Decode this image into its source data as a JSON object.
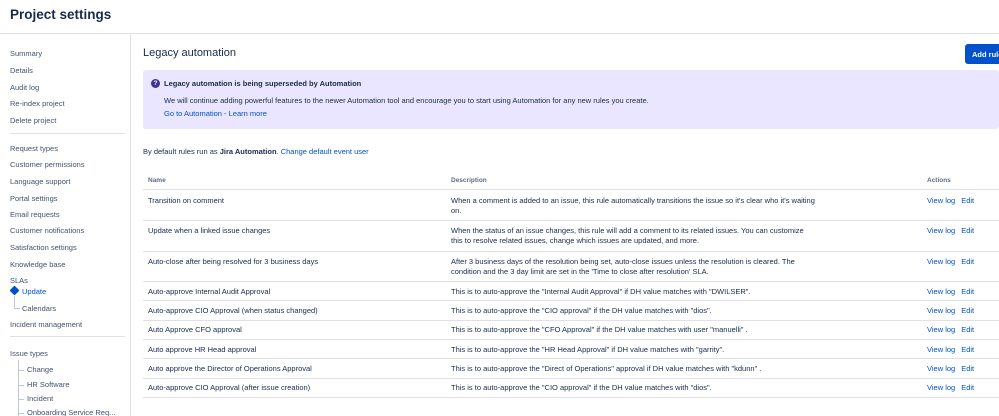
{
  "header": {
    "title": "Project settings"
  },
  "sidebar": {
    "group1": [
      "Summary",
      "Details",
      "Audit log",
      "Re-index project",
      "Delete project"
    ],
    "group2": [
      "Request types",
      "Customer permissions",
      "Language support",
      "Portal settings",
      "Email requests",
      "Customer notifications",
      "Satisfaction settings",
      "Knowledge base"
    ],
    "slas": {
      "label": "SLAs",
      "update": "Update",
      "calendars": "Calendars"
    },
    "incident": "Incident management",
    "issue_types": {
      "label": "Issue types",
      "items": [
        "Change",
        "HR Software",
        "Incident",
        "Onboarding Service Req..."
      ]
    }
  },
  "main": {
    "title": "Legacy automation",
    "add_rule": "Add rule",
    "banner": {
      "heading": "Legacy automation is being superseded by Automation",
      "body": "We will continue adding powerful features to the newer Automation tool and encourage you to start using Automation for any new rules you create.",
      "link1": "Go to Automation",
      "separator": " - ",
      "link2": "Learn more"
    },
    "default_prefix": "By default rules run as ",
    "default_user": "Jira Automation",
    "default_suffix": ". ",
    "default_link": "Change default event user",
    "columns": {
      "name": "Name",
      "description": "Description",
      "actions": "Actions"
    },
    "actions": {
      "view": "View log",
      "edit": "Edit"
    },
    "rules": [
      {
        "name": "Transition on comment",
        "description": "When a comment is added to an issue, this rule automatically transitions the issue so it's clear who it's waiting on."
      },
      {
        "name": "Update when a linked issue changes",
        "description": "When the status of an issue changes, this rule will add a comment to its related issues. You can customize this to resolve related issues, change which issues are updated, and more."
      },
      {
        "name": "Auto-close after being resolved for 3 business days",
        "description": "After 3 business days of the resolution being set, auto-close issues unless the resolution is cleared. The condition and the 3 day limit are set in the 'Time to close after resolution' SLA."
      },
      {
        "name": "Auto-approve Internal Audit Approval",
        "description": "This is to auto-approve the \"Internal Audit Approval\" if DH value matches with \"DWILSER\"."
      },
      {
        "name": "Auto-approve CIO Approval (when status changed)",
        "description": "This is to auto-approve the \"CIO approval\" if the DH value matches with \"dios\"."
      },
      {
        "name": "Auto Approve CFO approval",
        "description": "This is to auto-approve the \"CFO Approval\" if the DH value matches with user \"manuelli\" ."
      },
      {
        "name": "Auto approve HR Head approval",
        "description": "This is to auto-approve the \"HR Head Approval\" if DH value matches with \"garrity\"."
      },
      {
        "name": "Auto approve the Director of Operations Approval",
        "description": "This is to auto-approve the \"Direct of Operations\" approval if DH value matches with \"kdunn\" ."
      },
      {
        "name": "Auto-approve CIO Approval (after issue creation)",
        "description": "This is to auto-approve the \"CIO approval\" if the DH value matches with \"dios\"."
      }
    ]
  }
}
